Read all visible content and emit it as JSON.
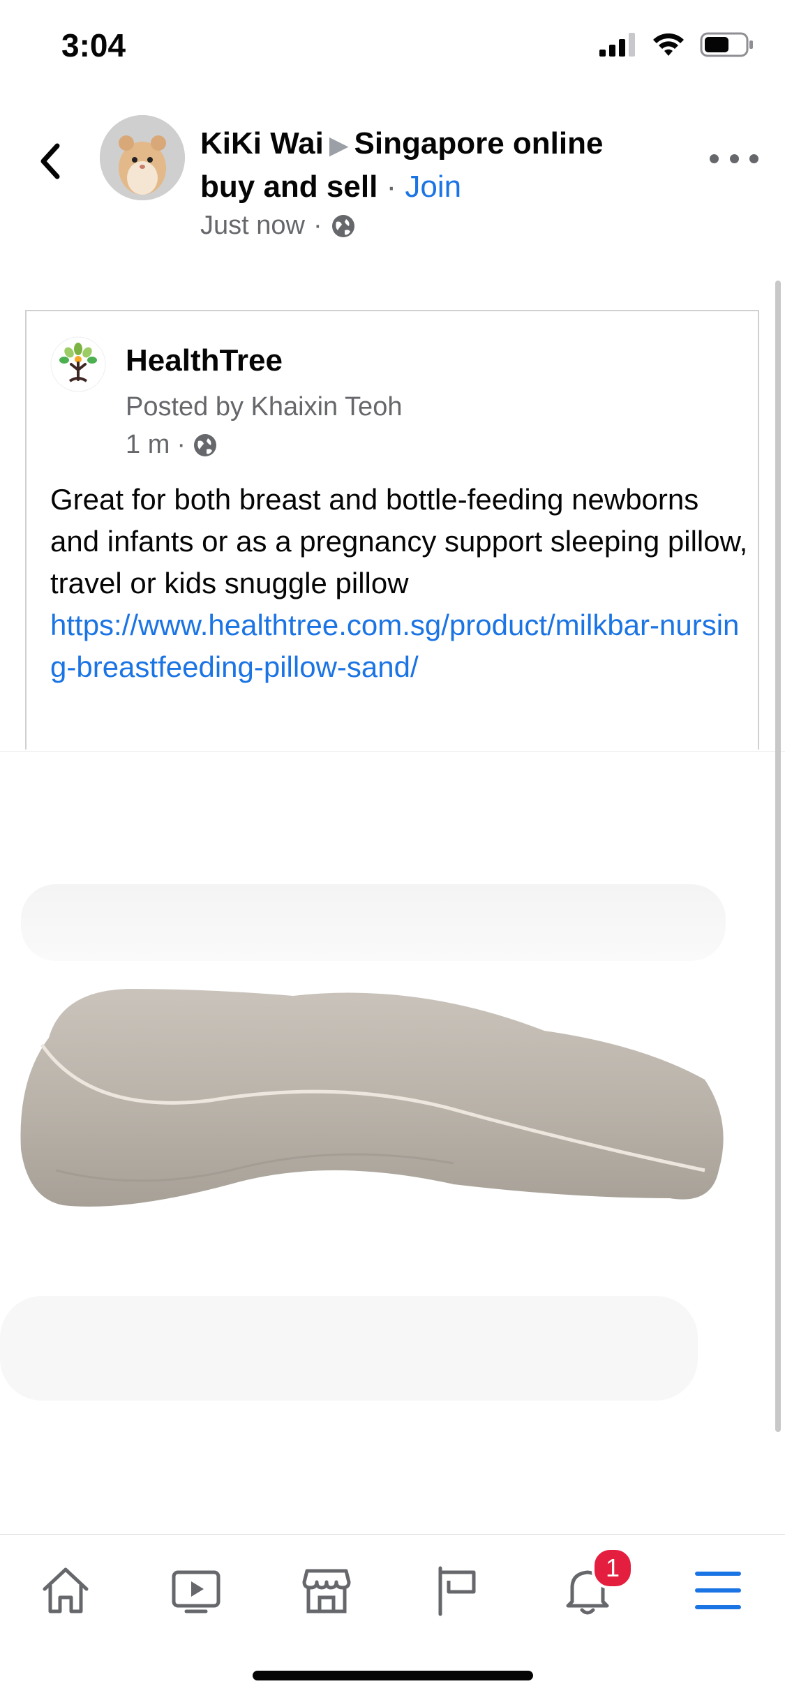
{
  "status_bar": {
    "time": "3:04"
  },
  "header": {
    "author": "KiKi Wai",
    "group_line1": "Singapore online",
    "group_line2": "buy and sell",
    "join_label": "Join",
    "timestamp": "Just now"
  },
  "shared_post": {
    "page_name": "HealthTree",
    "posted_by": "Posted by Khaixin Teoh",
    "time": "1 m",
    "text": "Great for both breast and bottle-feeding newborns and infants or as a pregnancy support sleeping pillow, travel or kids snuggle pillow",
    "link": "https://www.healthtree.com.sg/product/milkbar-nursing-breastfeeding-pillow-sand/"
  },
  "bottom_nav": {
    "notification_count": "1",
    "active_tab": "menu"
  },
  "colors": {
    "accent": "#1b74e4",
    "badge": "#e41e3f",
    "secondary_text": "#65676b"
  }
}
